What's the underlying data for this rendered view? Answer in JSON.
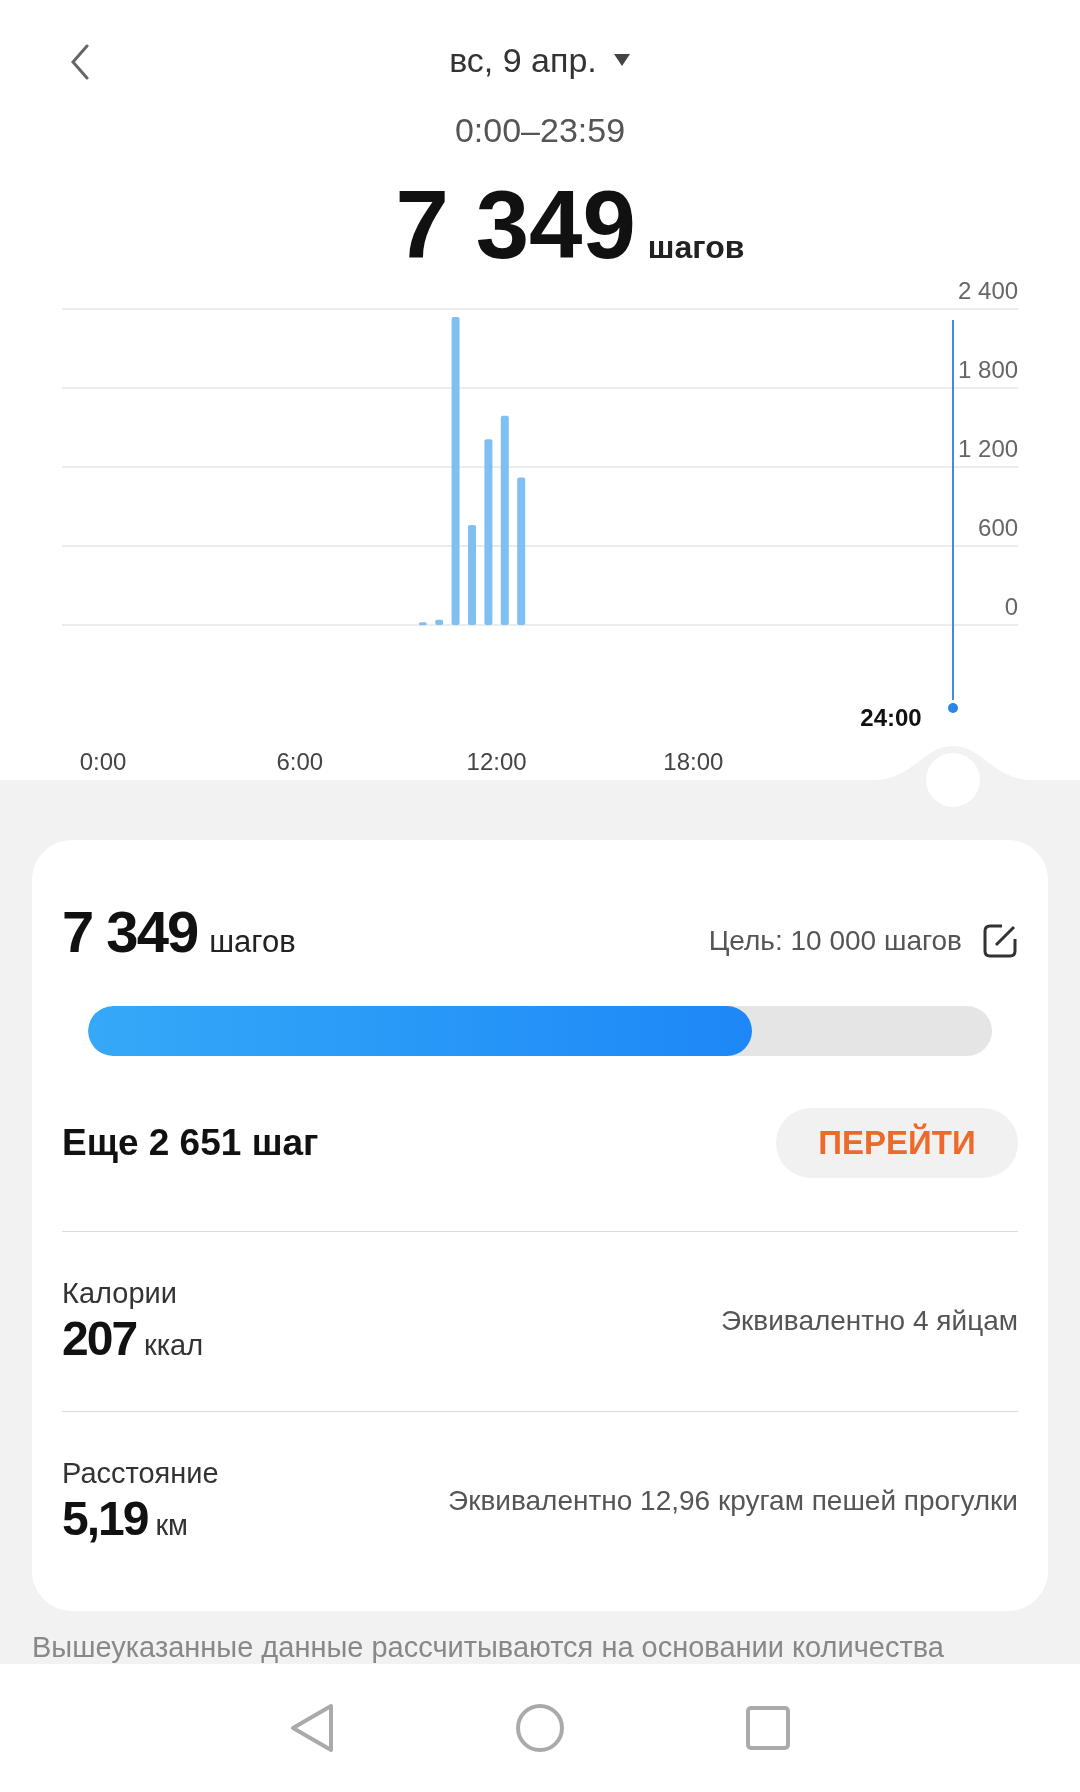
{
  "header": {
    "date": "вс, 9 апр.",
    "time_range": "0:00–23:59",
    "total": {
      "value": "7 349",
      "unit": "шагов"
    }
  },
  "chart": {
    "cursor_label": "24:00",
    "chart_data": {
      "type": "bar",
      "x": [
        9.75,
        10.25,
        10.75,
        11.25,
        11.75,
        12.25,
        12.75
      ],
      "values": [
        20,
        40,
        2340,
        760,
        1410,
        1590,
        1120
      ],
      "xlim": [
        -1.25,
        27.9
      ],
      "ylim": [
        0,
        2400
      ],
      "grid": true,
      "xticks": [
        {
          "value": 0,
          "label": "0:00"
        },
        {
          "value": 6,
          "label": "6:00"
        },
        {
          "value": 12,
          "label": "12:00"
        },
        {
          "value": 18,
          "label": "18:00"
        }
      ],
      "yticks": [
        {
          "value": 0,
          "label": "0"
        },
        {
          "value": 600,
          "label": "600"
        },
        {
          "value": 1200,
          "label": "1 200"
        },
        {
          "value": 1800,
          "label": "1 800"
        },
        {
          "value": 2400,
          "label": "2 400"
        }
      ]
    }
  },
  "summary": {
    "steps": {
      "value": "7 349",
      "unit": "шагов"
    },
    "goal": "Цель: 10 000 шагов",
    "progress": {
      "level": 0.7349
    },
    "remaining": "Еще 2 651 шаг",
    "go_button": "ПЕРЕЙТИ",
    "metrics": [
      {
        "label": "Калории",
        "value": "207",
        "unit": "ккал",
        "equivalent": "Эквивалентно 4 яйцам"
      },
      {
        "label": "Расстояние",
        "value": "5,19",
        "unit": "км",
        "equivalent": "Эквивалентно 12,96 кругам пешей прогулки"
      }
    ]
  },
  "footnote": "Вышеуказанные данные рассчитываются на основании количества"
}
